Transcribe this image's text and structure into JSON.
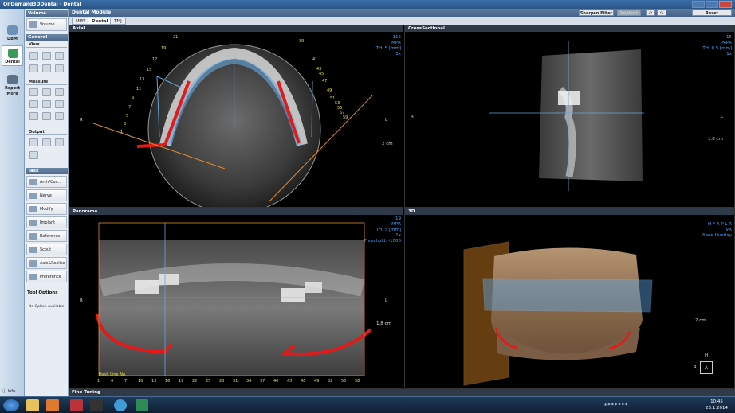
{
  "window": {
    "title": "OnDemand3DDental - Dental"
  },
  "left_rail": {
    "items": [
      {
        "label": "DBM",
        "color": "#6d8fb8"
      },
      {
        "label": "Dental",
        "color": "#3b9a5a"
      },
      {
        "label": "Report",
        "color": "#5b6f85"
      },
      {
        "label": "More"
      }
    ],
    "info": "Info."
  },
  "tool_panel": {
    "volume_header": "Volume",
    "volume_button": "Volume",
    "general_header": "General",
    "view_label": "View",
    "measure_label": "Measure",
    "output_label": "Output",
    "task_header": "Task",
    "tasks": [
      "Arch/Cur...",
      "Nerve",
      "Modify",
      "Implant",
      "Reference",
      "Scout",
      "Axis&Reslice",
      "Preference"
    ],
    "tool_options_header": "Tool Options",
    "tool_options_text": "No Option Available"
  },
  "module_bar": {
    "title": "Dental Module",
    "sharpen": "Sharpen Filter",
    "implant": "Implant",
    "reset": "Reset"
  },
  "tabs": [
    "MPR",
    "Dental",
    "TMJ"
  ],
  "viewports": {
    "axial": {
      "title": "Axial",
      "info": [
        "116",
        "MPR",
        "TH: 5 [mm]",
        "1x"
      ],
      "left_label": "R",
      "right_label": "L",
      "scale": "2 cm",
      "tooth_numbers": [
        "1",
        "3",
        "5",
        "7",
        "9",
        "11",
        "13",
        "15",
        "17",
        "19",
        "21",
        "39",
        "41",
        "43",
        "45",
        "47",
        "49",
        "51",
        "53",
        "55",
        "57",
        "59"
      ]
    },
    "cross": {
      "title": "CrossSectional",
      "info": [
        "15",
        "MPR",
        "TH: 0.5 [mm]",
        "1x"
      ],
      "left_label": "R",
      "right_label": "L",
      "scale": "1.8 cm"
    },
    "panorama": {
      "title": "Panorama",
      "info": [
        "19",
        "MPR",
        "TH: 5 [mm]",
        "1x",
        "Threshold: -1000"
      ],
      "left_label": "R",
      "right_label": "L",
      "scale": "1.8 cm",
      "hash_label": "Hash Line No.",
      "hash_numbers": [
        "1",
        "4",
        "7",
        "10",
        "13",
        "16",
        "19",
        "22",
        "25",
        "28",
        "31",
        "34",
        "37",
        "40",
        "43",
        "46",
        "49",
        "52",
        "55",
        "58"
      ]
    },
    "v3d": {
      "title": "3D",
      "info": [
        "H F A P L R",
        "VR",
        "Plane Overlay"
      ],
      "scale": "2 cm",
      "cube_top": "H",
      "cube_left": "R",
      "cube_face": "A"
    }
  },
  "fine_tuning": "Fine Tuning",
  "taskbar": {
    "time": "10:45",
    "date": "23.1.2014"
  }
}
